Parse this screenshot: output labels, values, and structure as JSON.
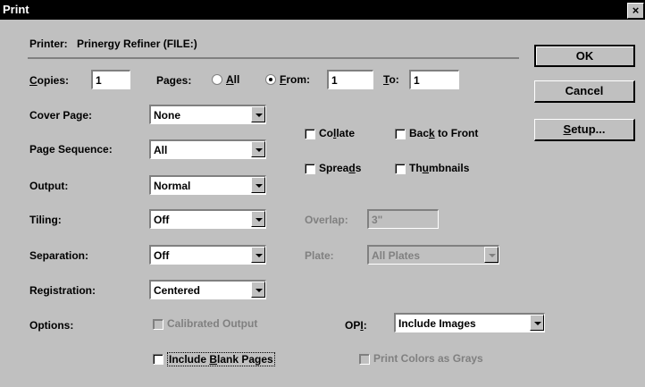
{
  "window": {
    "title": "Print",
    "close": "×"
  },
  "printer": {
    "label": "Printer:",
    "name": "Prinergy Refiner (FILE:)"
  },
  "copies": {
    "label": "Copies:",
    "value": "1"
  },
  "pages": {
    "label": "Pages:",
    "all_label": "All",
    "from_label": "From:",
    "from_value": "1",
    "to_label": "To:",
    "to_value": "1",
    "selected": "from"
  },
  "cover_page": {
    "label": "Cover Page:",
    "value": "None"
  },
  "page_sequence": {
    "label": "Page Sequence:",
    "value": "All"
  },
  "output": {
    "label": "Output:",
    "value": "Normal"
  },
  "tiling": {
    "label": "Tiling:",
    "value": "Off"
  },
  "overlap": {
    "label": "Overlap:",
    "value": "3\""
  },
  "separation": {
    "label": "Separation:",
    "value": "Off"
  },
  "plate": {
    "label": "Plate:",
    "value": "All Plates"
  },
  "registration": {
    "label": "Registration:",
    "value": "Centered"
  },
  "options": {
    "label": "Options:",
    "calibrated_output": "Calibrated Output",
    "include_blank_pages": "Include Blank Pages",
    "print_colors_as_grays": "Print Colors as Grays"
  },
  "opi": {
    "label": "OPI:",
    "value": "Include Images"
  },
  "checks": {
    "collate": "Collate",
    "back_to_front": "Back to Front",
    "spreads": "Spreads",
    "thumbnails": "Thumbnails"
  },
  "buttons": {
    "ok": "OK",
    "cancel": "Cancel",
    "setup": "Setup..."
  }
}
